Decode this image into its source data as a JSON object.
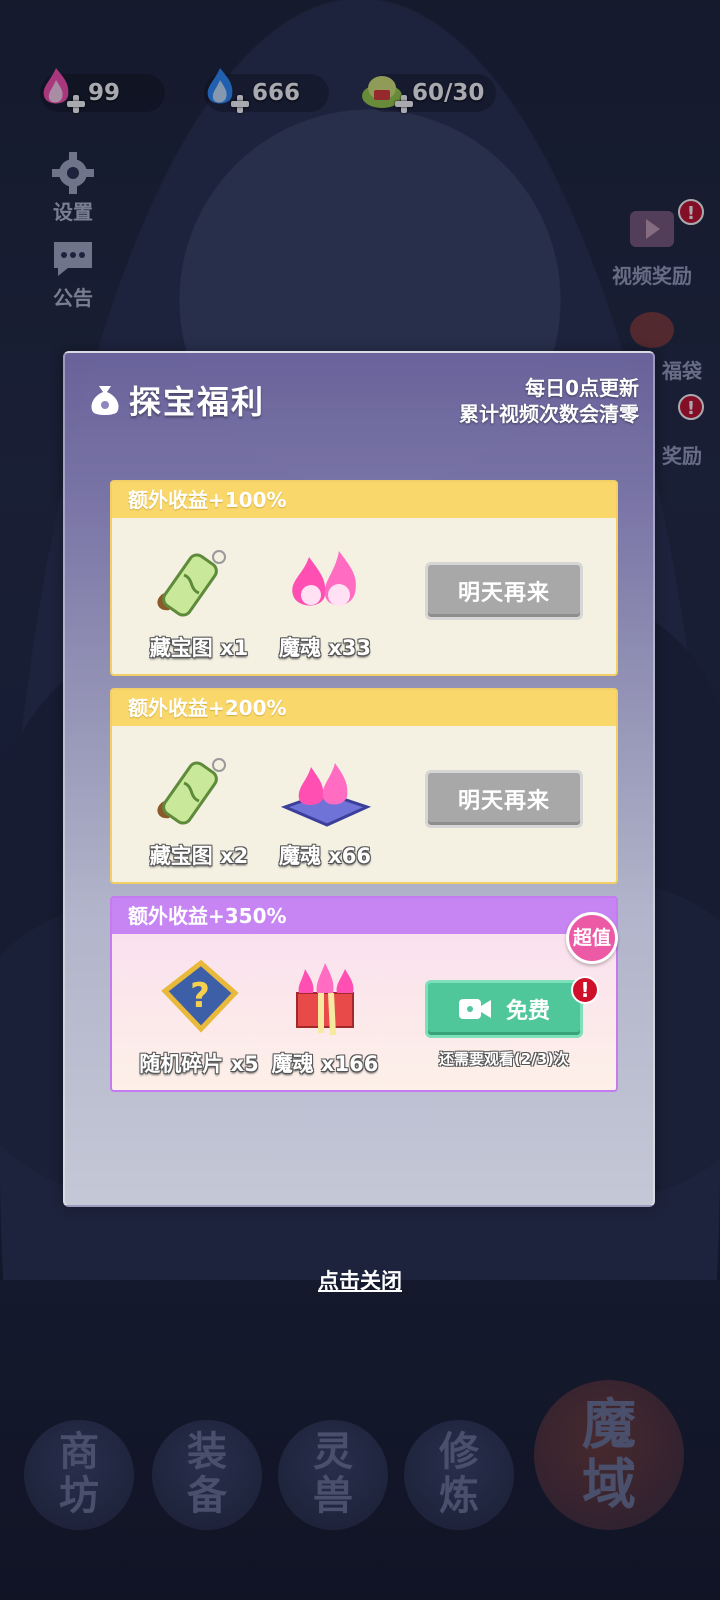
{
  "resources": [
    {
      "icon": "pink-soul-flame-icon",
      "value": "99"
    },
    {
      "icon": "blue-soul-flame-icon",
      "value": "666"
    },
    {
      "icon": "treasure-pile-icon",
      "value": "60/30"
    }
  ],
  "side_menu": [
    {
      "icon": "gear-icon",
      "label": "设置"
    },
    {
      "icon": "chat-bubble-icon",
      "label": "公告"
    }
  ],
  "right_menu": [
    {
      "label": "视频奖励"
    },
    {
      "label": "福袋"
    },
    {
      "label": "奖励"
    }
  ],
  "bottom_nav": [
    {
      "label": "商坊"
    },
    {
      "label": "装备"
    },
    {
      "label": "灵兽"
    },
    {
      "label": "修炼"
    },
    {
      "label": "魔域"
    }
  ],
  "dialog": {
    "title": "探宝福利",
    "note_line1": "每日0点更新",
    "note_line2": "累计视频次数会清零",
    "cards": [
      {
        "header": "额外收益+100%",
        "rewards": [
          {
            "icon": "treasure-map-scroll-icon",
            "label": "藏宝图 x1"
          },
          {
            "icon": "soul-flame-icon",
            "label": "魔魂 x33"
          }
        ],
        "button": "明天再来"
      },
      {
        "header": "额外收益+200%",
        "rewards": [
          {
            "icon": "treasure-map-scroll-icon",
            "label": "藏宝图 x2"
          },
          {
            "icon": "soul-flame-cushion-icon",
            "label": "魔魂 x66"
          }
        ],
        "button": "明天再来"
      },
      {
        "header": "额外收益+350%",
        "badge": "超值",
        "rewards": [
          {
            "icon": "random-fragment-icon",
            "label": "随机碎片 x5"
          },
          {
            "icon": "soul-flame-giftbox-icon",
            "label": "魔魂 x166"
          }
        ],
        "button": "免费",
        "remaining": "还需要观看(2/3)次"
      }
    ]
  },
  "close_text": "点击关闭",
  "colors": {
    "card_yellow": "#f9d76a",
    "card_purple": "#c685f2",
    "button_gray": "#a8a8a8",
    "button_green": "#4fc79a",
    "badge_pink": "#ec5aa5",
    "alert_red": "#d0102b"
  }
}
